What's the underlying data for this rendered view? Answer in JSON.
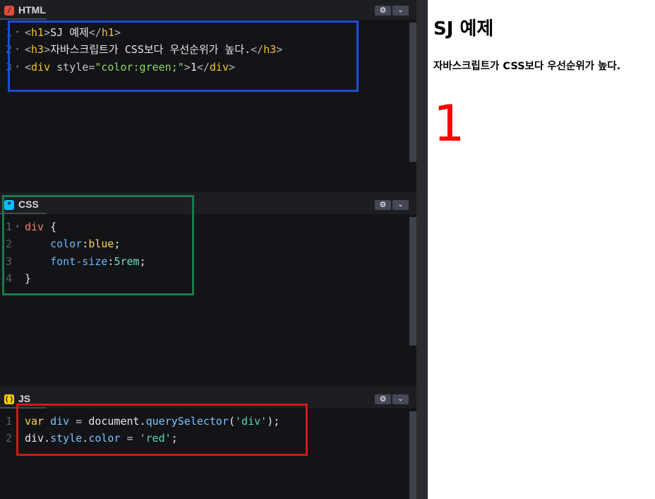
{
  "panes": {
    "html": {
      "title": "HTML",
      "icon": "/",
      "lines": [
        {
          "n": "1",
          "tokens": [
            [
              "br",
              "<"
            ],
            [
              "tag",
              "h1"
            ],
            [
              "br",
              ">"
            ],
            [
              "txt",
              "SJ 예제"
            ],
            [
              "br",
              "</"
            ],
            [
              "tag",
              "h1"
            ],
            [
              "br",
              ">"
            ]
          ]
        },
        {
          "n": "2",
          "tokens": [
            [
              "br",
              "<"
            ],
            [
              "tag",
              "h3"
            ],
            [
              "br",
              ">"
            ],
            [
              "txt",
              "자바스크립트가 CSS보다 우선순위가 높다."
            ],
            [
              "br",
              "</"
            ],
            [
              "tag",
              "h3"
            ],
            [
              "br",
              ">"
            ]
          ]
        },
        {
          "n": "3",
          "tokens": [
            [
              "br",
              "<"
            ],
            [
              "tag",
              "div"
            ],
            [
              "attr",
              " style"
            ],
            [
              "br",
              "="
            ],
            [
              "str",
              "\"color:green;\""
            ],
            [
              "br",
              ">"
            ],
            [
              "txt",
              "1"
            ],
            [
              "br",
              "</"
            ],
            [
              "tag",
              "div"
            ],
            [
              "br",
              ">"
            ]
          ]
        }
      ]
    },
    "css": {
      "title": "CSS",
      "icon": "*",
      "lines": [
        {
          "n": "1",
          "tokens": [
            [
              "sel",
              "div"
            ],
            [
              "txt",
              " {"
            ]
          ]
        },
        {
          "n": "2",
          "tokens": [
            [
              "txt",
              "    "
            ],
            [
              "prop",
              "color"
            ],
            [
              "txt",
              ":"
            ],
            [
              "val",
              "blue"
            ],
            [
              "txt",
              ";"
            ]
          ]
        },
        {
          "n": "3",
          "tokens": [
            [
              "txt",
              "    "
            ],
            [
              "prop",
              "font-size"
            ],
            [
              "txt",
              ":"
            ],
            [
              "num",
              "5rem"
            ],
            [
              "txt",
              ";"
            ]
          ]
        },
        {
          "n": "4",
          "tokens": [
            [
              "txt",
              "}"
            ]
          ]
        }
      ]
    },
    "js": {
      "title": "JS",
      "icon": "()",
      "lines": [
        {
          "n": "1",
          "tokens": [
            [
              "kw",
              "var"
            ],
            [
              "txt",
              " "
            ],
            [
              "var",
              "div"
            ],
            [
              "op",
              " = "
            ],
            [
              "txt",
              "document."
            ],
            [
              "fn",
              "querySelector"
            ],
            [
              "txt",
              "("
            ],
            [
              "jstr",
              "'div'"
            ],
            [
              "txt",
              ");"
            ]
          ]
        },
        {
          "n": "2",
          "tokens": [
            [
              "txt",
              "div."
            ],
            [
              "fn",
              "style"
            ],
            [
              "txt",
              "."
            ],
            [
              "fn",
              "color"
            ],
            [
              "op",
              " = "
            ],
            [
              "jstr",
              "'red'"
            ],
            [
              "txt",
              ";"
            ]
          ]
        }
      ]
    },
    "settings_icon": "gear-icon",
    "collapse_icon": "chevron-down-icon"
  },
  "preview": {
    "h1": "SJ 예제",
    "h3": "자바스크립트가 CSS보다 우선순위가 높다.",
    "div": "1",
    "div_color": "#ff0000"
  },
  "highlights": {
    "html_color": "#1a4fd6",
    "css_color": "#1a7a4a",
    "js_color": "#d31919"
  }
}
